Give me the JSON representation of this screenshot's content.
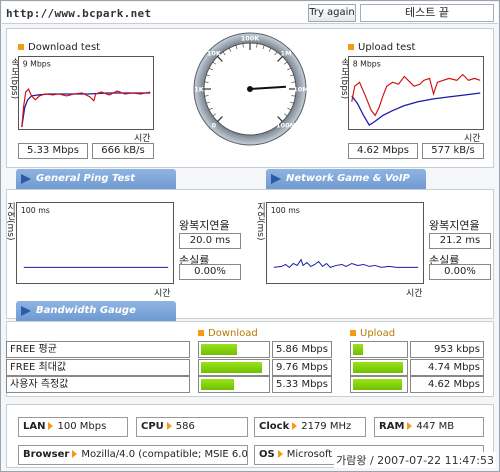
{
  "header": {
    "url": "http://www.bcpark.net",
    "try_again": "Try again",
    "status": "테스트 끝"
  },
  "download": {
    "title": "Download test",
    "y_axis": "속도(bps)",
    "scale": "9 Mbps",
    "x_axis": "시간",
    "speed_mbps": "5.33 Mbps",
    "speed_kbs": "666 kB/s"
  },
  "upload": {
    "title": "Upload test",
    "y_axis": "속도(bps)",
    "scale": "8 Mbps",
    "x_axis": "시간",
    "speed_mbps": "4.62 Mbps",
    "speed_kbs": "577 kB/s"
  },
  "gauge": {
    "ticks": [
      "0",
      "1K",
      "10K",
      "100K",
      "1M",
      "10M",
      "100M"
    ],
    "level": 0.82
  },
  "tabs": {
    "ping": "General Ping Test",
    "game": "Network Game & VoIP Test",
    "bandwidth": "Bandwidth Gauge"
  },
  "ping": {
    "y_axis": "지연(ms)",
    "scale": "100 ms",
    "x_axis": "시간",
    "rtt_label": "왕복지연율",
    "rtt_value": "20.0 ms",
    "loss_label": "손실률",
    "loss_value": "0.00%"
  },
  "game": {
    "y_axis": "지연(ms)",
    "scale": "100 ms",
    "x_axis": "시간",
    "rtt_label": "왕복지연율",
    "rtt_value": "21.2 ms",
    "loss_label": "손실률",
    "loss_value": "0.00%"
  },
  "bandwidth": {
    "download_title": "Download",
    "upload_title": "Upload",
    "rows": [
      {
        "label": "FREE 평균",
        "dl_fill": 0.55,
        "dl_value": "5.86 Mbps",
        "ul_fill": 0.2,
        "ul_value": "953 kbps"
      },
      {
        "label": "FREE 최대값",
        "dl_fill": 0.92,
        "dl_value": "9.76 Mbps",
        "ul_fill": 0.97,
        "ul_value": "4.74 Mbps"
      },
      {
        "label": "사용자 측정값",
        "dl_fill": 0.5,
        "dl_value": "5.33 Mbps",
        "ul_fill": 0.95,
        "ul_value": "4.62 Mbps"
      }
    ]
  },
  "system": {
    "lan_key": "LAN",
    "lan_val": "100 Mbps",
    "cpu_key": "CPU",
    "cpu_val": "586",
    "clock_key": "Clock",
    "clock_val": "2179 MHz",
    "ram_key": "RAM",
    "ram_val": "447 MB",
    "browser_key": "Browser",
    "browser_val": "Mozilla/4.0 (compatible; MSIE 6.0",
    "os_key": "OS",
    "os_val": "Microsoft"
  },
  "footer": {
    "stamp": "가람왕 / 2007-07-22 11:47:53"
  },
  "colors": {
    "download_line": "#d01010",
    "baseline_line": "#1a1aa8",
    "tab_blue": "#6f9ad0",
    "accent_orange": "#f39c12",
    "bar_green": "#7fd000"
  }
}
